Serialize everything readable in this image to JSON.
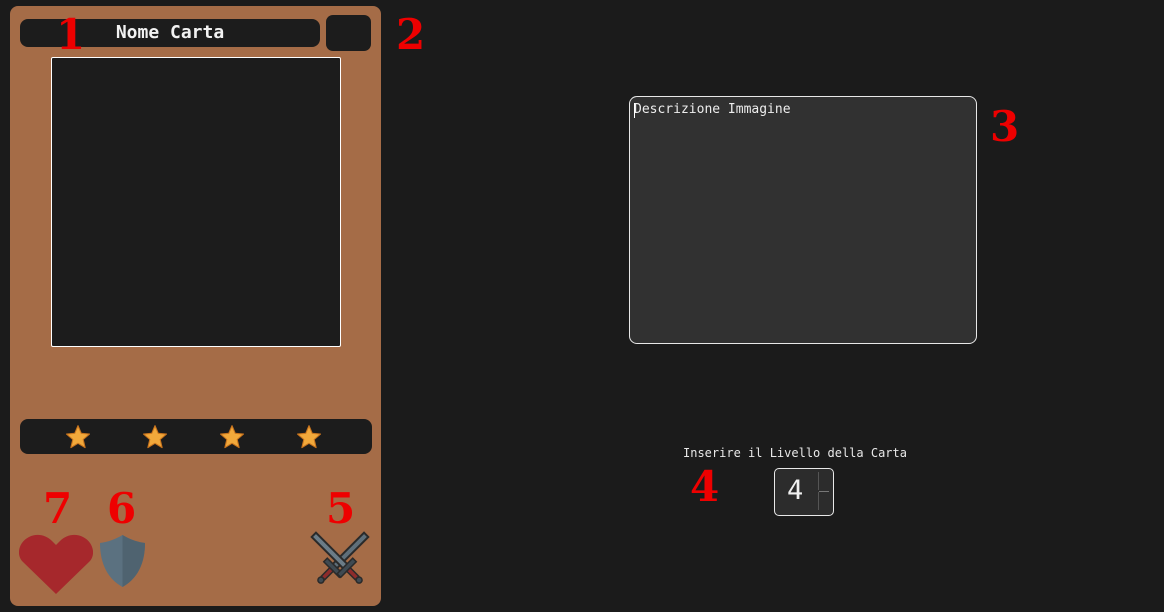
{
  "card": {
    "name": "Nome Carta",
    "cost_value": "",
    "stars": 4,
    "colors": {
      "card_bg": "#a56c47",
      "panel_bg": "#1c1c1c",
      "heart": "#a6282c",
      "shield": "#5b7180",
      "star": "#f2a93b"
    },
    "icons": [
      "star-icon",
      "heart-icon",
      "shield-icon",
      "crossed-swords-icon"
    ]
  },
  "annotations": {
    "n1": "1",
    "n2": "2",
    "n3": "3",
    "n4": "4",
    "n5": "5",
    "n6": "6",
    "n7": "7",
    "color": "#ee0000"
  },
  "description": {
    "placeholder": "Descrizione Immagine",
    "value": ""
  },
  "level": {
    "label": "Inserire il Livello della Carta",
    "value": "4"
  }
}
